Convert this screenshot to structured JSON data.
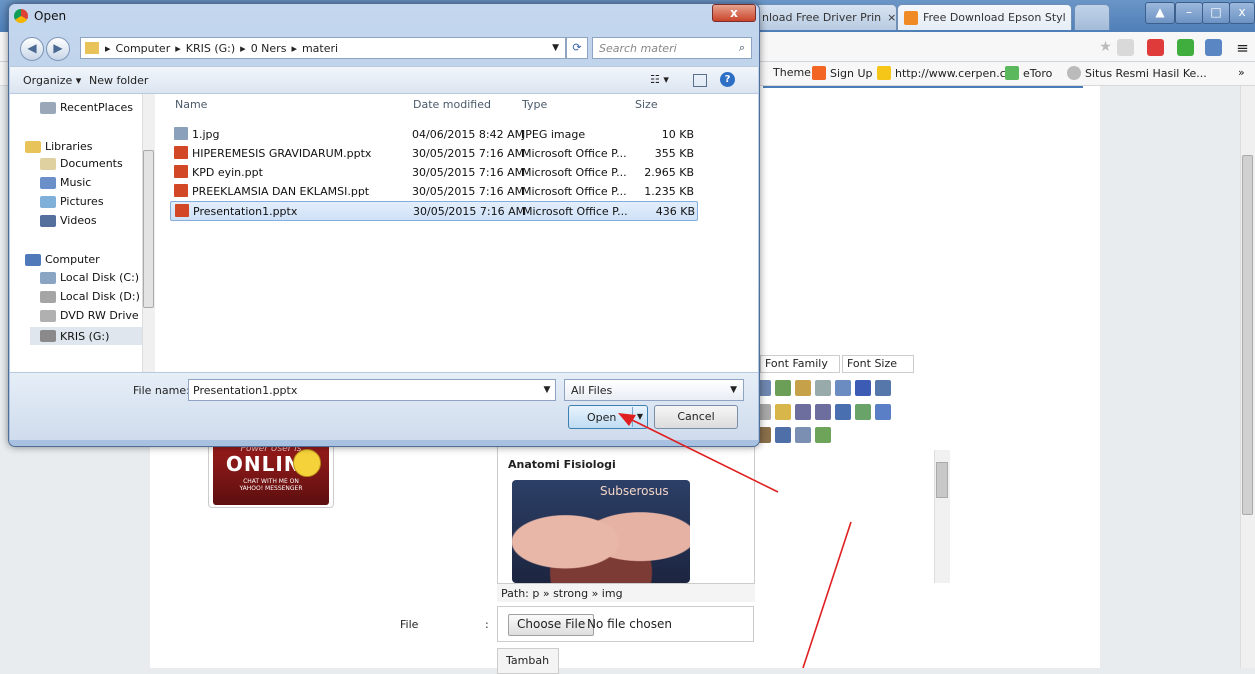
{
  "browser": {
    "tabs": [
      {
        "label": "nload Free Driver Prin",
        "close": "×",
        "color": "#5a8ed6"
      },
      {
        "label": "Free Download Epson Styl",
        "close": "×",
        "color": "#f08a24"
      }
    ],
    "bookmarks": [
      {
        "label": "Theme",
        "color": "#e8e8e8"
      },
      {
        "label": "Sign Up",
        "color": "#f26522"
      },
      {
        "label": "http://www.cerpen.c...",
        "color": "#f5c518"
      },
      {
        "label": "eToro",
        "color": "#5cb85c"
      },
      {
        "label": "Situs Resmi Hasil Ke...",
        "color": "#bbbbbb"
      }
    ],
    "more_bookmarks": "»"
  },
  "page": {
    "editor": {
      "font_family": "Font Family",
      "font_size": "Font Size",
      "heading": "Anatomi Fisiologi",
      "image_caption": "Subserosus",
      "path": "Path: p » strong » img"
    },
    "file_label": "File",
    "file_colon": ":",
    "choose_file": "Choose File",
    "no_file": "No file chosen",
    "submit": "Tambah",
    "badge": {
      "line1": "Power User is",
      "line2": "ONLINE",
      "line3": "CHAT WITH ME ON",
      "line4": "YAHOO! MESSENGER"
    }
  },
  "dialog": {
    "title": "Open",
    "close": "x",
    "breadcrumb": [
      "Computer",
      "KRIS (G:)",
      "0 Ners",
      "materi"
    ],
    "search_placeholder": "Search materi",
    "organize": "Organize ▾",
    "new_folder": "New folder",
    "nav": [
      {
        "label": "RecentPlaces",
        "color": "#9aa7b8"
      },
      {
        "label": "Libraries",
        "color": "#e7c35a"
      },
      {
        "label": "Documents",
        "color": "#e0d2a0"
      },
      {
        "label": "Music",
        "color": "#6a8fc9"
      },
      {
        "label": "Pictures",
        "color": "#7fb0d9"
      },
      {
        "label": "Videos",
        "color": "#556f9c"
      },
      {
        "label": "Computer",
        "color": "#4f79b8"
      },
      {
        "label": "Local Disk (C:)",
        "color": "#8aa4c4"
      },
      {
        "label": "Local Disk (D:)",
        "color": "#a5a5a5"
      },
      {
        "label": "DVD RW Drive (E",
        "color": "#b0b0b0"
      },
      {
        "label": "KRIS (G:)",
        "color": "#8a8a8a"
      }
    ],
    "columns": {
      "name": "Name",
      "date": "Date modified",
      "type": "Type",
      "size": "Size"
    },
    "files": [
      {
        "name": "1.jpg",
        "date": "04/06/2015 8:42 AM",
        "type": "JPEG image",
        "size": "10 KB",
        "icon": "#8aa0bb"
      },
      {
        "name": "HIPEREMESIS GRAVIDARUM.pptx",
        "date": "30/05/2015 7:16 AM",
        "type": "Microsoft Office P...",
        "size": "355 KB",
        "icon": "#d24726"
      },
      {
        "name": "KPD eyin.ppt",
        "date": "30/05/2015 7:16 AM",
        "type": "Microsoft Office P...",
        "size": "2.965 KB",
        "icon": "#d24726"
      },
      {
        "name": "PREEKLAMSIA DAN EKLAMSI.ppt",
        "date": "30/05/2015 7:16 AM",
        "type": "Microsoft Office P...",
        "size": "1.235 KB",
        "icon": "#d24726"
      },
      {
        "name": "Presentation1.pptx",
        "date": "30/05/2015 7:16 AM",
        "type": "Microsoft Office P...",
        "size": "436 KB",
        "icon": "#d24726"
      }
    ],
    "filename_label": "File name:",
    "filename_value": "Presentation1.pptx",
    "filter": "All Files",
    "open": "Open",
    "cancel": "Cancel"
  }
}
